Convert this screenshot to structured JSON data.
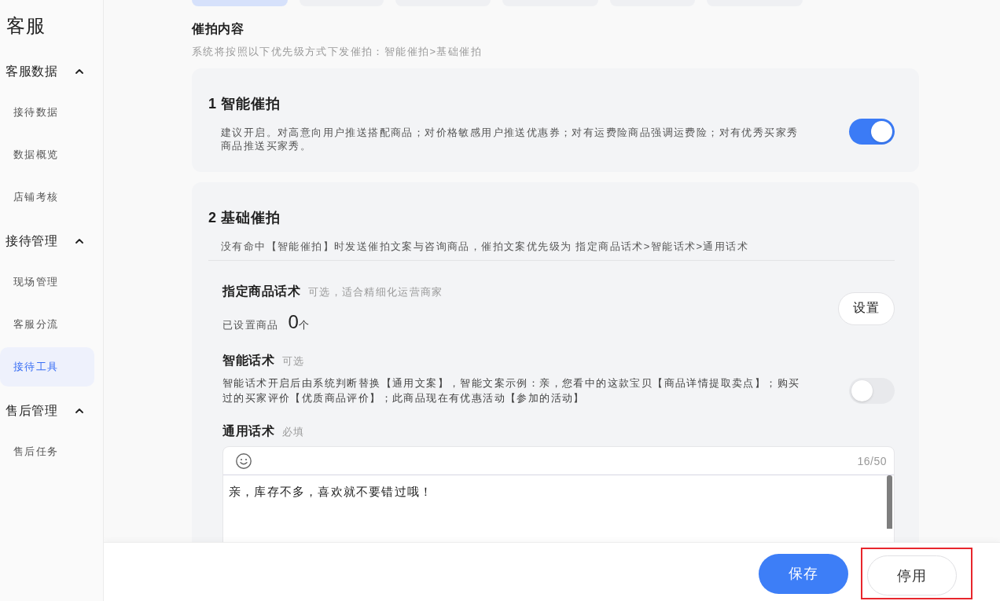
{
  "sidebar": {
    "title": "客服",
    "groups": [
      {
        "label": "客服数据",
        "expanded": true,
        "items": [
          {
            "label": "接待数据",
            "selected": false
          },
          {
            "label": "数据概览",
            "selected": false
          },
          {
            "label": "店铺考核",
            "selected": false
          }
        ]
      },
      {
        "label": "接待管理",
        "expanded": true,
        "items": [
          {
            "label": "现场管理",
            "selected": false
          },
          {
            "label": "客服分流",
            "selected": false
          },
          {
            "label": "接待工具",
            "selected": true
          }
        ]
      },
      {
        "label": "售后管理",
        "expanded": true,
        "items": [
          {
            "label": "售后任务",
            "selected": false
          }
        ]
      }
    ]
  },
  "tabs": [
    {
      "selected": true
    },
    {
      "selected": false
    },
    {
      "selected": false
    },
    {
      "selected": false
    },
    {
      "selected": false
    },
    {
      "selected": false
    }
  ],
  "section": {
    "title": "催拍内容",
    "subtitle": "系统将按照以下优先级方式下发催拍：智能催拍>基础催拍"
  },
  "cards": [
    {
      "kind": "switch",
      "title": "1 智能催拍",
      "description": "建议开启。对高意向用户推送搭配商品；对价格敏感用户推送优惠券；对有运费险商品强调运费险；对有优秀买家秀商品推送买家秀。",
      "on": true
    },
    {
      "kind": "group",
      "title": "2 基础催拍",
      "description": "没有命中【智能催拍】时发送催拍文案与咨询商品，催拍文案优先级为 指定商品话术>智能话术>通用话术",
      "options": [
        {
          "kind": "products",
          "title": "指定商品话术",
          "note": "可选，适合精细化运营商家",
          "count_label": "已设置商品",
          "count": "0",
          "count_unit": "个",
          "button": "设置"
        },
        {
          "kind": "switch",
          "title": "智能话术",
          "note": "可选",
          "description": "智能话术开启后由系统判断替换【通用文案】，智能文案示例：亲，您看中的这款宝贝【商品详情提取卖点】；购买过的买家评价【优质商品评价】；此商品现在有优惠活动【参加的活动】",
          "on": false
        },
        {
          "kind": "editor",
          "title": "通用话术",
          "note": "必填",
          "counter": "16/50",
          "value": "亲，库存不多，喜欢就不要错过哦！"
        }
      ]
    }
  ],
  "footer": {
    "buttons": [
      {
        "label": "保存",
        "kind": "primary",
        "highlighted": false
      },
      {
        "label": "停用",
        "kind": "secondary",
        "highlighted": true
      }
    ]
  }
}
